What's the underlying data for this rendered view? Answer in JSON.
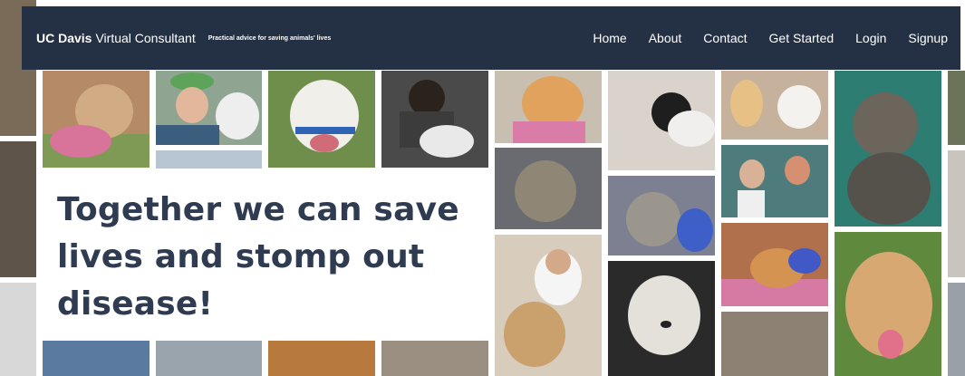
{
  "navbar": {
    "brand_bold": "UC Davis",
    "brand_rest": "Virtual Consultant",
    "tagline": "Practical advice for saving animals' lives",
    "links": [
      {
        "label": "Home"
      },
      {
        "label": "About"
      },
      {
        "label": "Contact"
      },
      {
        "label": "Get Started"
      },
      {
        "label": "Login"
      },
      {
        "label": "Signup"
      }
    ]
  },
  "hero": {
    "heading": "Together we can save lives and stomp out disease!"
  },
  "collage": {
    "photos": [
      {
        "subject": "pit bull puppy with pink toy",
        "color": "#b58a66"
      },
      {
        "subject": "woman in green cap holding dog",
        "color": "#8fa592"
      },
      {
        "subject": "white pit bull on grass",
        "color": "#6f8e4b"
      },
      {
        "subject": "vet with dog on table",
        "color": "#4a4a4a"
      },
      {
        "subject": "orange kitten in pink towel",
        "color": "#d19a5c"
      },
      {
        "subject": "gloved hands with black kitten",
        "color": "#d9d3cb"
      },
      {
        "subject": "woman with white puppy",
        "color": "#c6b29c"
      },
      {
        "subject": "tabby kitten on blanket",
        "color": "#6a6b70"
      },
      {
        "subject": "tabby cat portrait",
        "color": "#5d5a55"
      },
      {
        "subject": "cat held with blue glove",
        "color": "#7d8090"
      },
      {
        "subject": "veterinarians in green scrubs",
        "color": "#4e7c7c"
      },
      {
        "subject": "orange kitten with blue glove",
        "color": "#b0704c"
      },
      {
        "subject": "beagle smiling",
        "color": "#c29b6a"
      },
      {
        "subject": "vet examining yellow dog",
        "color": "#b99877"
      },
      {
        "subject": "white fluffy puppy",
        "color": "#d6d3cd"
      },
      {
        "subject": "kitten and man",
        "color": "#8c8173"
      },
      {
        "subject": "group of people",
        "color": "#5b7aa0"
      },
      {
        "subject": "dog and people",
        "color": "#9aa4ad"
      },
      {
        "subject": "orange cat",
        "color": "#b8793e"
      },
      {
        "subject": "kittens on floor",
        "color": "#9a8f80"
      },
      {
        "subject": "edge dog",
        "color": "#7a6a58"
      },
      {
        "subject": "edge white",
        "color": "#d8d8d8"
      }
    ]
  },
  "colors": {
    "navbar_bg": "#243044",
    "navbar_text": "#ffffff",
    "hero_text": "#2f3b51",
    "hero_bg": "#ffffff"
  }
}
